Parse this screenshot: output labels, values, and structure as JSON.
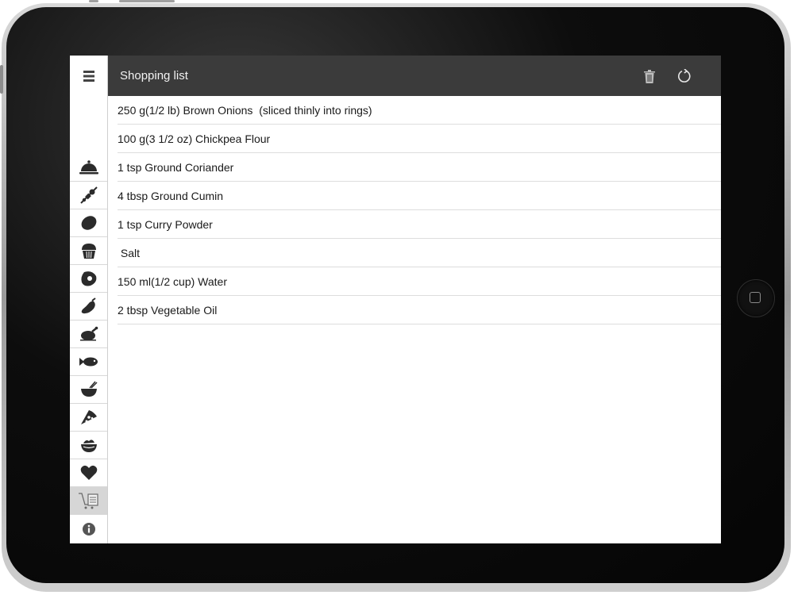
{
  "header": {
    "title": "Shopping list",
    "delete_icon": "trash-icon",
    "refresh_icon": "refresh-icon"
  },
  "sidebar": {
    "menu_icon": "hamburger-menu-icon",
    "categories": [
      {
        "icon": "cloche-icon"
      },
      {
        "icon": "kebab-skewer-icon"
      },
      {
        "icon": "potato-icon"
      },
      {
        "icon": "cupcake-icon"
      },
      {
        "icon": "steak-icon"
      },
      {
        "icon": "eggplant-icon"
      },
      {
        "icon": "roast-chicken-icon"
      },
      {
        "icon": "fish-icon"
      },
      {
        "icon": "noodle-bowl-icon"
      },
      {
        "icon": "pizza-slice-icon"
      },
      {
        "icon": "salad-bowl-icon"
      },
      {
        "icon": "heart-icon"
      },
      {
        "icon": "shopping-cart-list-icon",
        "selected": true
      },
      {
        "icon": "info-icon"
      }
    ]
  },
  "shopping_list": {
    "items": [
      "250 g(1/2 lb) Brown Onions  (sliced thinly into rings)",
      "100 g(3 1/2 oz) Chickpea Flour",
      "1 tsp Ground Coriander",
      "4 tbsp Ground Cumin",
      "1 tsp Curry Powder",
      " Salt",
      "150 ml(1/2 cup) Water",
      "2 tbsp Vegetable Oil"
    ]
  },
  "colors": {
    "header_bg": "#3b3b3b",
    "icon_fill": "#2b2b2b",
    "selected_bg": "#d6d6d6"
  }
}
